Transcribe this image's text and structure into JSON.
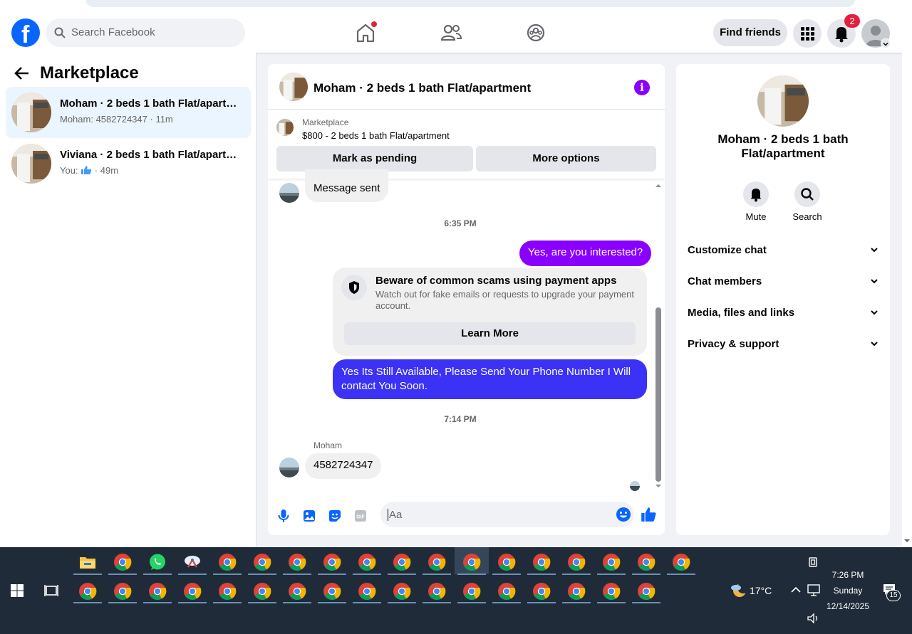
{
  "header": {
    "search_placeholder": "Search Facebook",
    "find_friends_label": "Find friends",
    "notification_count": "2"
  },
  "left": {
    "title": "Marketplace",
    "conversations": [
      {
        "name": "Moham · 2 beds 1 bath Flat/apartment",
        "preview_prefix": "Moham: 4582724347",
        "time": "11m"
      },
      {
        "name": "Viviana · 2 beds 1 bath Flat/apartment",
        "preview_prefix": "You:",
        "time": "49m"
      }
    ]
  },
  "chat": {
    "title": "Moham · 2 beds 1 bath Flat/apartment",
    "listing_source": "Marketplace",
    "listing_price": "$800 - 2 beds 1 bath Flat/apartment",
    "mark_pending": "Mark as pending",
    "more_options": "More options",
    "messages": {
      "message_sent": "Message sent",
      "time1": "6:35 PM",
      "out1": "Yes, are you interested?",
      "scam_title": "Beware of common scams using payment apps",
      "scam_body": "Watch out for fake emails or requests to upgrade your payment account.",
      "learn_more": "Learn More",
      "out2": "Yes Its Still Available, Please Send Your Phone Number I Will contact You Soon.",
      "time2": "7:14 PM",
      "sender": "Moham",
      "in2": "4582724347"
    },
    "composer_placeholder": "Aa"
  },
  "right": {
    "name": "Moham · 2 beds 1 bath Flat/apartment",
    "mute": "Mute",
    "search": "Search",
    "sections": [
      "Customize chat",
      "Chat members",
      "Media, files and links",
      "Privacy & support"
    ]
  },
  "taskbar": {
    "weather": "17°C",
    "time": "7:26 PM",
    "day": "Sunday",
    "date": "12/14/2025",
    "notif_count": "15"
  },
  "colors": {
    "fb_blue": "#0866ff",
    "messenger_purple": "#8a00ff",
    "bubble_blue": "#3b32f5",
    "badge_red": "#e41e3f"
  }
}
